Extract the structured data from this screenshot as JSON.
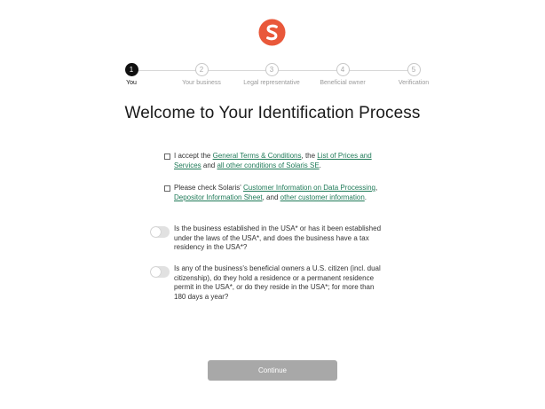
{
  "brand": {
    "logo_icon": "solaris-s-logo-icon",
    "logo_color": "#e9583a"
  },
  "stepper": {
    "steps": [
      {
        "number": "1",
        "label": "You"
      },
      {
        "number": "2",
        "label": "Your business"
      },
      {
        "number": "3",
        "label": "Legal representative"
      },
      {
        "number": "4",
        "label": "Beneficial owner"
      },
      {
        "number": "5",
        "label": "Verification"
      }
    ],
    "active_step": 1
  },
  "title": "Welcome to Your Identification Process",
  "consent1": {
    "pre": "I accept the ",
    "link1": "General Terms & Conditions",
    "mid1": ", the ",
    "link2": "List of Prices and Services",
    "mid2": " and ",
    "link3": "all other conditions of Solaris SE",
    "post": ".",
    "checked": false
  },
  "consent2": {
    "pre": "Please check Solaris' ",
    "link1": "Customer Information on Data Processing",
    "mid1": ", ",
    "link2": "Depositor Information Sheet",
    "mid2": ", and ",
    "link3": "other customer information",
    "post": ".",
    "checked": false
  },
  "question1": {
    "text": "Is the business established in the USA* or has it been established under the laws of the USA*, and does the business have a tax residency in the USA*?",
    "on": false
  },
  "question2": {
    "text": "Is any of the business's beneficial owners a U.S. citizen (incl. dual citizenship), do they hold a residence or a permanent residence permit in the USA*, or do they reside in the USA*; for more than 180 days a year?",
    "on": false
  },
  "continue_button": {
    "label": "Continue",
    "enabled": false
  }
}
